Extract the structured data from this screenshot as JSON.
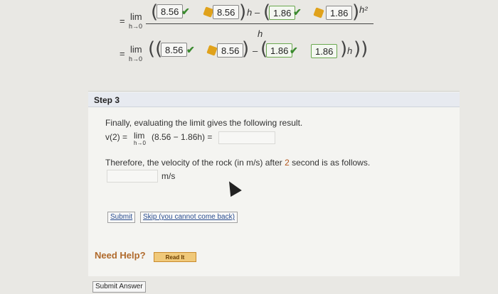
{
  "line1": {
    "eq": "=",
    "lim": "lim",
    "sub": "h→0",
    "val1": "8.56",
    "val2": "8.56",
    "var_h": "h",
    "minus": "–",
    "val3": "1.86",
    "val4": "1.86",
    "power": "h²",
    "denominator": "h"
  },
  "line2": {
    "eq": "=",
    "lim": "lim",
    "sub": "h→0",
    "val1": "8.56",
    "val2": "8.56",
    "minus": "–",
    "val3": "1.86",
    "val4": "1.86",
    "var_h": "h"
  },
  "step": {
    "title": "Step 3",
    "intro": "Finally, evaluating the limit gives the following result.",
    "v_lhs": "v(2) =",
    "lim": "lim",
    "lim_sub": "h→0",
    "expr": "(8.56 − 1.86h) =",
    "velocity_text_pre": "Therefore, the velocity of the rock (in m/s) after ",
    "velocity_num": "2",
    "velocity_text_post": " second is as follows.",
    "unit": "m/s",
    "submit_label": "Submit",
    "skip_label": "Skip (you cannot come back)"
  },
  "help": {
    "label": "Need Help?",
    "read_it": "Read It"
  },
  "footer": {
    "submit_answer": "Submit Answer"
  },
  "colors": {
    "check": "#3a8a2e",
    "key": "#e0a21b",
    "help": "#b06a2c",
    "link": "#2a4d8f"
  }
}
